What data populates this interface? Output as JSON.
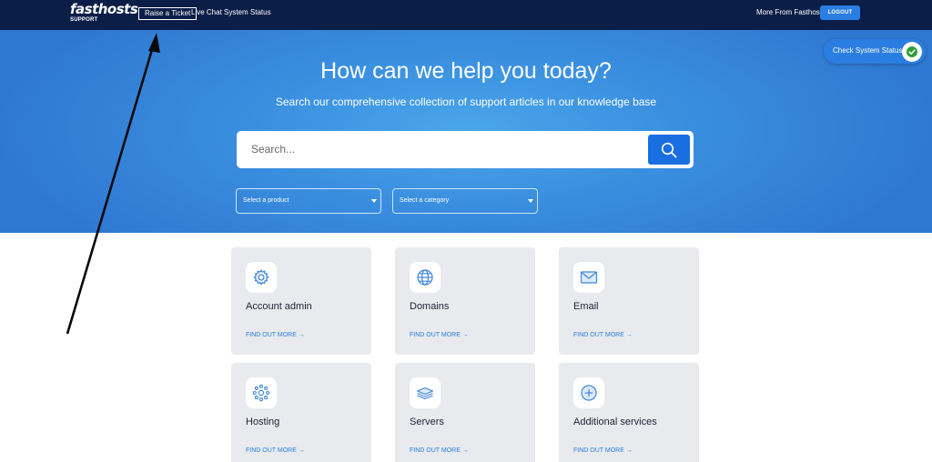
{
  "nav": {
    "logo": "fasthosts",
    "logo_sub": "SUPPORT",
    "raise_ticket": "Raise a Ticket",
    "live_chat": "Live Chat",
    "system_status": "System Status",
    "more_from": "More From Fasthosts",
    "logout": "LOGOUT"
  },
  "hero": {
    "title": "How can we help you today?",
    "subtitle": "Search our comprehensive collection of support articles in our knowledge base",
    "search_placeholder": "Search...",
    "product_select": "Select a product",
    "category_select": "Select a category"
  },
  "status_pill": {
    "label": "Check System Status"
  },
  "cards": [
    {
      "title": "Account admin",
      "link": "FIND OUT MORE →",
      "icon": "gear-icon"
    },
    {
      "title": "Domains",
      "link": "FIND OUT MORE →",
      "icon": "globe-icon"
    },
    {
      "title": "Email",
      "link": "FIND OUT MORE →",
      "icon": "envelope-icon"
    },
    {
      "title": "Hosting",
      "link": "FIND OUT MORE →",
      "icon": "hosting-dots-icon"
    },
    {
      "title": "Servers",
      "link": "FIND OUT MORE →",
      "icon": "server-stack-icon"
    },
    {
      "title": "Additional services",
      "link": "FIND OUT MORE →",
      "icon": "plus-circle-icon"
    }
  ],
  "colors": {
    "nav_bg": "#0b1e48",
    "accent": "#2a7de1",
    "card_bg": "#e8eaee",
    "status_ok": "#2e9e3a"
  }
}
